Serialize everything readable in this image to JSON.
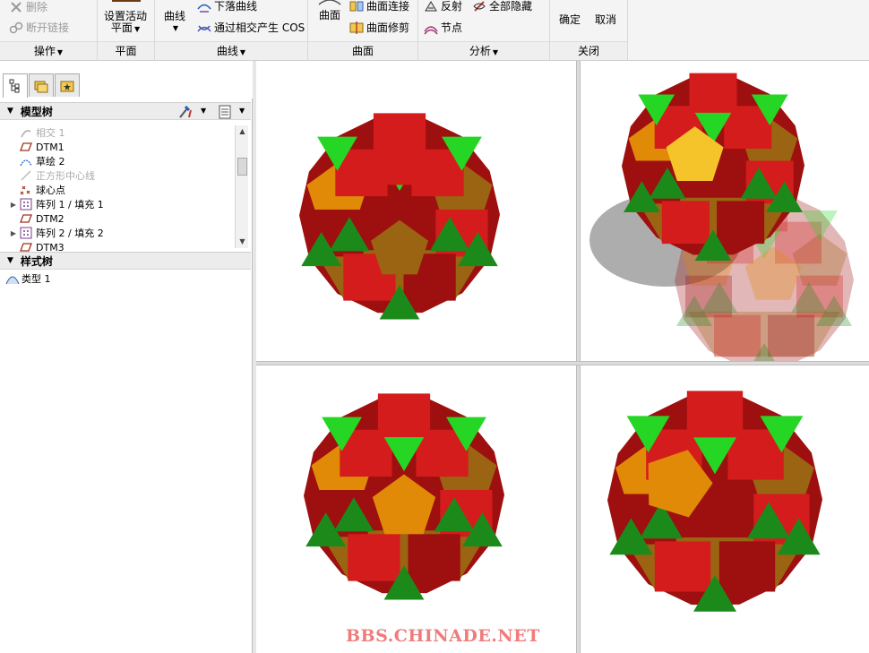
{
  "ribbon": {
    "groups": {
      "operations": {
        "title": "操作",
        "delete": "删除",
        "break_link": "断开链接"
      },
      "plane": {
        "title": "平面",
        "set_active_line1": "设置活动",
        "set_active_line2": "平面"
      },
      "curves": {
        "title": "曲线",
        "curve": "曲线",
        "drop_curve": "下落曲线",
        "cos": "通过相交产生 COS"
      },
      "surfaces": {
        "title": "曲面",
        "surface": "曲面",
        "connect": "曲面连接",
        "trim": "曲面修剪"
      },
      "analysis": {
        "title": "分析",
        "reflect": "反射",
        "hide_all": "全部隐藏",
        "node": "节点"
      },
      "close": {
        "title": "关闭",
        "ok": "确定",
        "cancel": "取消"
      }
    }
  },
  "model_tree": {
    "title": "模型树",
    "items": [
      {
        "label": "相交 1",
        "icon": "intersect-icon",
        "disabled": true,
        "expandable": false
      },
      {
        "label": "DTM1",
        "icon": "datum-plane-icon",
        "disabled": false,
        "expandable": false
      },
      {
        "label": "草绘 2",
        "icon": "sketch-icon",
        "disabled": false,
        "expandable": false
      },
      {
        "label": "正方形中心线",
        "icon": "centerline-icon",
        "disabled": true,
        "expandable": false
      },
      {
        "label": "球心点",
        "icon": "datum-point-icon",
        "disabled": false,
        "expandable": false
      },
      {
        "label": "阵列 1 / 填充 1",
        "icon": "pattern-icon",
        "disabled": false,
        "expandable": true
      },
      {
        "label": "DTM2",
        "icon": "datum-plane-icon",
        "disabled": false,
        "expandable": false
      },
      {
        "label": "阵列 2 / 填充 2",
        "icon": "pattern-icon",
        "disabled": false,
        "expandable": true
      },
      {
        "label": "DTM3",
        "icon": "datum-plane-icon",
        "disabled": false,
        "expandable": false
      }
    ]
  },
  "style_tree": {
    "title": "样式树",
    "items": [
      {
        "label": "类型 1",
        "icon": "style-type-icon"
      }
    ]
  },
  "colors": {
    "red": "#d41c1c",
    "dark_red": "#9e0f0f",
    "green": "#25d625",
    "dark_green": "#1b8a1b",
    "orange": "#e08a08",
    "brown": "#9a6412",
    "watermark": "#f07b7b"
  },
  "watermark": "BBS.CHINADE.NET"
}
